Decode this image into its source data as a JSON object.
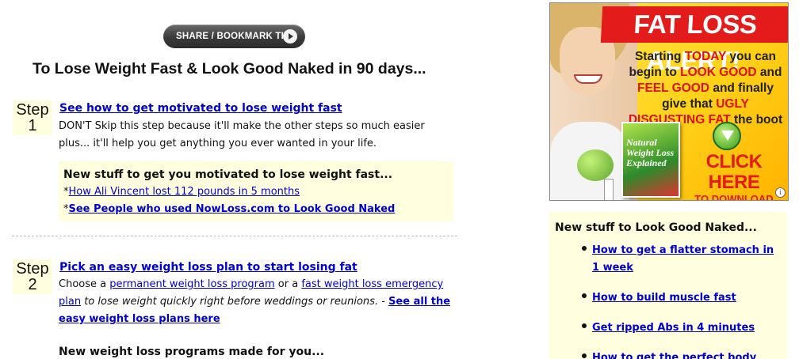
{
  "share": {
    "label": "SHARE / BOOKMARK THIS"
  },
  "title": "To Lose Weight Fast & Look Good Naked in 90 days...",
  "step1": {
    "badge_word": "Step",
    "badge_num": "1",
    "link": "See how to get motivated to lose weight fast",
    "text_line1": "DON'T Skip this step because it'll make the other steps so much easier",
    "text_line2": "plus... it'll help you get anything you ever wanted in your life.",
    "box": {
      "title": "New stuff to get you motivated to lose weight fast...",
      "item1_prefix": "*",
      "item1_link": "How Ali Vincent lost 112 pounds in 5 months",
      "item2_prefix": "*",
      "item2_link": "See People who used NowLoss.com to Look Good Naked"
    }
  },
  "step2": {
    "badge_word": "Step",
    "badge_num": "2",
    "link": "Pick an easy weight loss plan to start losing fat",
    "choose": "Choose a ",
    "link_permanent": "permanent weight loss program",
    "or": " or a ",
    "link_emergency": "fast weight loss emergency plan",
    "italic_text": " to lose weight quickly right before weddings or reunions.",
    "dash": " - ",
    "link_see_all": "See all the easy weight loss plans here"
  },
  "programs_heading": "New weight loss programs made for you...",
  "ad": {
    "headline": "FAT LOSS ALERT!",
    "copy_1": "Starting ",
    "copy_today": "TODAY",
    "copy_2": " you can begin to ",
    "copy_look": "LOOK GOOD",
    "copy_3": " and ",
    "copy_feel": "FEEL GOOD",
    "copy_4": " and finally give that ",
    "copy_ugly": "UGLY DISGUSTING FAT",
    "copy_5": " the boot",
    "book_title": "Natural Weight Loss Explained",
    "cta_big": "CLICK HERE",
    "cta_small": "TO DOWNLOAD YOUR SPECIAL REPORT",
    "info": "i"
  },
  "sidebar": {
    "title": "New stuff to Look Good Naked...",
    "items": [
      {
        "label": "How to get a flatter stomach in 1 week"
      },
      {
        "label": "How to build muscle fast"
      },
      {
        "label": "Get ripped Abs in 4 minutes"
      },
      {
        "label": "How to get the perfect body"
      }
    ]
  },
  "colors": {
    "link": "#0000cc",
    "highlight_bg": "#ffffe0",
    "ad_red": "#e31b1b",
    "ad_yellow": "#ffd21a"
  }
}
